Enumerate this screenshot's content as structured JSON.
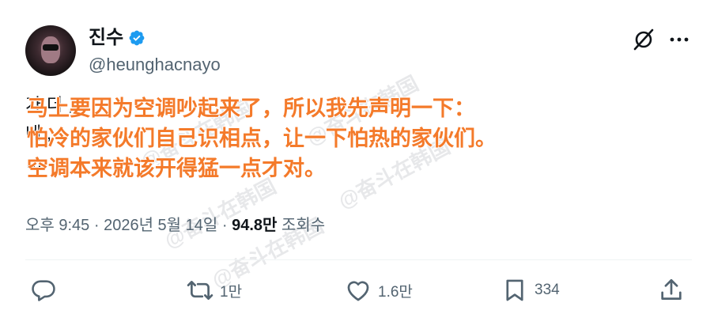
{
  "author": {
    "display_name": "진수",
    "handle": "@heunghacnayo"
  },
  "tweet": {
    "lines": [
      "가 더  ,",
      "  네   ,",
      "…"
    ],
    "overlay_lines": [
      "马上要因为空调吵起来了，所以我先声明一下：",
      "怕冷的家伙们自己识相点，让一下怕热的家伙们。",
      "空调本来就该开得猛一点才对。"
    ],
    "watermark": "@奋斗在韩国"
  },
  "meta": {
    "time": "오후 9:45",
    "separator": "·",
    "date": "2026년 5월 14일",
    "views_count": "94.8만",
    "views_label": "조회수"
  },
  "actions": {
    "reply_count": "",
    "retweet_count": "1만",
    "like_count": "1.6만",
    "bookmark_count": "334"
  },
  "colors": {
    "accent": "#1d9bf0",
    "overlay": "#f47a2a",
    "muted": "#536471"
  },
  "icons": [
    "verified-badge-icon",
    "grok-icon",
    "more-icon",
    "reply-icon",
    "retweet-icon",
    "like-icon",
    "bookmark-icon",
    "share-icon"
  ]
}
